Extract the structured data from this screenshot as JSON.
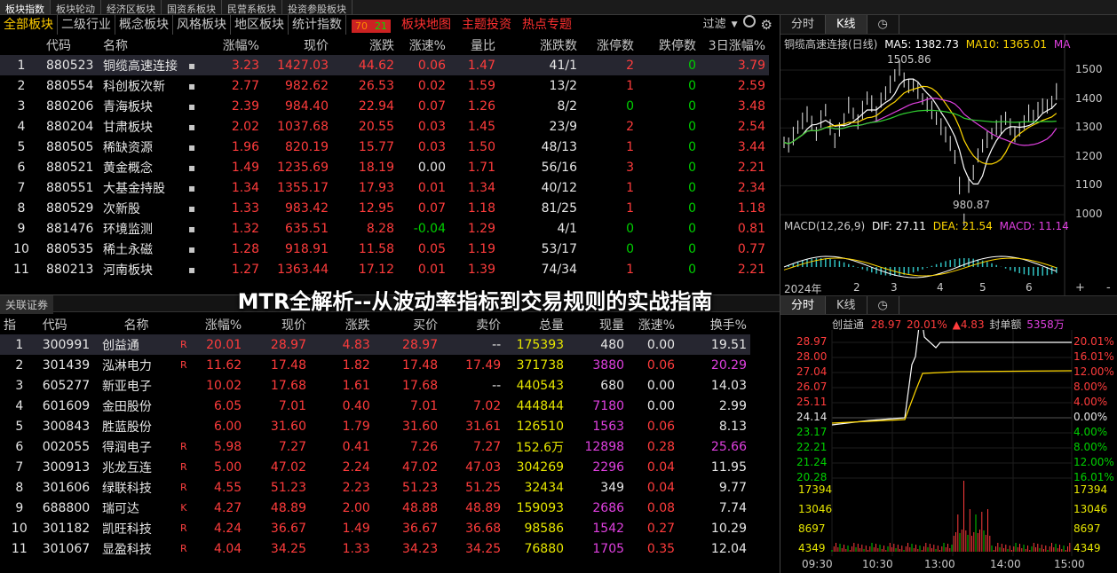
{
  "top_tabs": [
    "板块指数",
    "板块轮动",
    "经济区板块",
    "国资系板块",
    "民营系板块",
    "投资参股板块"
  ],
  "section_tabs": [
    "全部板块",
    "二级行业",
    "概念板块",
    "风格板块",
    "地区板块",
    "统计指数"
  ],
  "up_badge": "70",
  "down_badge": "21",
  "red_tabs": [
    "板块地图",
    "主题投资",
    "热点专题"
  ],
  "filter_label": "过滤",
  "sector_table": {
    "headers": [
      "代码",
      "名称",
      "",
      "涨幅%",
      "现价",
      "涨跌",
      "涨速%",
      "量比",
      "涨跌数",
      "涨停数",
      "跌停数",
      "3日涨幅%"
    ],
    "rows": [
      [
        "1",
        "880523",
        "铜缆高速连接",
        "3.23",
        "1427.03",
        "44.62",
        "0.06",
        "1.47",
        "41/1",
        "2",
        "0",
        "3.79"
      ],
      [
        "2",
        "880554",
        "科创板次新",
        "2.77",
        "982.62",
        "26.53",
        "0.02",
        "1.59",
        "13/2",
        "1",
        "0",
        "2.59"
      ],
      [
        "3",
        "880206",
        "青海板块",
        "2.39",
        "984.40",
        "22.94",
        "0.07",
        "1.26",
        "8/2",
        "0",
        "0",
        "3.48"
      ],
      [
        "4",
        "880204",
        "甘肃板块",
        "2.02",
        "1037.68",
        "20.55",
        "0.03",
        "1.45",
        "23/9",
        "2",
        "0",
        "2.54"
      ],
      [
        "5",
        "880505",
        "稀缺资源",
        "1.96",
        "820.19",
        "15.77",
        "0.03",
        "1.50",
        "48/13",
        "1",
        "0",
        "3.44"
      ],
      [
        "6",
        "880521",
        "黄金概念",
        "1.49",
        "1235.69",
        "18.19",
        "0.00",
        "1.71",
        "56/16",
        "3",
        "0",
        "2.21"
      ],
      [
        "7",
        "880551",
        "大基金持股",
        "1.34",
        "1355.17",
        "17.93",
        "0.01",
        "1.34",
        "40/12",
        "1",
        "0",
        "2.34"
      ],
      [
        "8",
        "880529",
        "次新股",
        "1.33",
        "983.42",
        "12.95",
        "0.07",
        "1.18",
        "81/25",
        "1",
        "0",
        "1.18"
      ],
      [
        "9",
        "881476",
        "环境监测",
        "1.32",
        "635.51",
        "8.28",
        "-0.04",
        "1.29",
        "4/1",
        "0",
        "0",
        "0.81"
      ],
      [
        "10",
        "880535",
        "稀土永磁",
        "1.28",
        "918.91",
        "11.58",
        "0.05",
        "1.19",
        "53/17",
        "0",
        "0",
        "0.77"
      ],
      [
        "11",
        "880213",
        "河南板块",
        "1.27",
        "1363.44",
        "17.12",
        "0.01",
        "1.39",
        "74/34",
        "1",
        "0",
        "2.21"
      ]
    ]
  },
  "related_label": "关联证券",
  "overlay_title": "MTR全解析--从波动率指标到交易规则的实战指南",
  "stock_table": {
    "headers": [
      "指",
      "代码",
      "名称",
      "",
      "涨幅%",
      "现价",
      "涨跌",
      "买价",
      "卖价",
      "总量",
      "现量",
      "涨速%",
      "换手%"
    ],
    "rows": [
      [
        "1",
        "300991",
        "创益通",
        "R",
        "20.01",
        "28.97",
        "4.83",
        "28.97",
        "--",
        "175393",
        "480",
        "0.00",
        "19.51"
      ],
      [
        "2",
        "301439",
        "泓淋电力",
        "R",
        "11.62",
        "17.48",
        "1.82",
        "17.48",
        "17.49",
        "371738",
        "3880",
        "0.06",
        "20.29"
      ],
      [
        "3",
        "605277",
        "新亚电子",
        "",
        "10.02",
        "17.68",
        "1.61",
        "17.68",
        "--",
        "440543",
        "680",
        "0.00",
        "14.03"
      ],
      [
        "4",
        "601609",
        "金田股份",
        "",
        "6.05",
        "7.01",
        "0.40",
        "7.01",
        "7.02",
        "444844",
        "7180",
        "0.00",
        "2.99"
      ],
      [
        "5",
        "300843",
        "胜蓝股份",
        "",
        "6.00",
        "31.60",
        "1.79",
        "31.60",
        "31.61",
        "126510",
        "1563",
        "0.06",
        "8.13"
      ],
      [
        "6",
        "002055",
        "得润电子",
        "R",
        "5.98",
        "7.27",
        "0.41",
        "7.26",
        "7.27",
        "152.6万",
        "12898",
        "0.28",
        "25.66"
      ],
      [
        "7",
        "300913",
        "兆龙互连",
        "R",
        "5.00",
        "47.02",
        "2.24",
        "47.02",
        "47.03",
        "304269",
        "2296",
        "0.04",
        "11.95"
      ],
      [
        "8",
        "301606",
        "绿联科技",
        "R",
        "4.55",
        "51.23",
        "2.23",
        "51.23",
        "51.25",
        "32434",
        "349",
        "0.04",
        "9.77"
      ],
      [
        "9",
        "688800",
        "瑞可达",
        "K",
        "4.27",
        "48.89",
        "2.00",
        "48.88",
        "48.89",
        "159093",
        "2686",
        "0.08",
        "7.74"
      ],
      [
        "10",
        "301182",
        "凯旺科技",
        "R",
        "4.24",
        "36.67",
        "1.49",
        "36.67",
        "36.68",
        "98586",
        "1542",
        "0.27",
        "10.29"
      ],
      [
        "11",
        "301067",
        "显盈科技",
        "R",
        "4.04",
        "34.25",
        "1.33",
        "34.23",
        "34.25",
        "76880",
        "1705",
        "0.35",
        "12.04"
      ]
    ]
  },
  "kline": {
    "tabs": [
      "分时",
      "K线"
    ],
    "title": "铜缆高速连接(日线)",
    "ma5_label": "MA5: 1382.73",
    "ma10_label": "MA10: 1365.01",
    "ma20_label": "MA",
    "high_label": "1505.86",
    "low_label": "980.87",
    "y_ticks": [
      "1500",
      "1400",
      "1300",
      "1200",
      "1100",
      "1000"
    ],
    "macd_title": "MACD(12,26,9)",
    "dif_label": "DIF: 27.11",
    "dea_label": "DEA: 21.54",
    "macd_label": "MACD: 11.14",
    "x_ticks": [
      "2024年",
      "2",
      "3",
      "4",
      "5",
      "6"
    ]
  },
  "intraday": {
    "tabs": [
      "分时",
      "K线"
    ],
    "name": "创益通",
    "price": "28.97",
    "pct": "20.01%",
    "change": "▲4.83",
    "seal_label": "封单额",
    "seal_value": "5358万",
    "left_ticks": [
      "28.97",
      "28.00",
      "27.04",
      "26.07",
      "25.11",
      "24.14",
      "23.17",
      "22.21",
      "21.24",
      "20.28"
    ],
    "right_ticks": [
      "20.01%",
      "16.01%",
      "12.00%",
      "8.00%",
      "4.00%",
      "0.00%",
      "4.00%",
      "8.00%",
      "12.00%",
      "16.01%"
    ],
    "vol_ticks": [
      "17394",
      "13046",
      "8697",
      "4349"
    ],
    "time_ticks": [
      "09:30",
      "10:30",
      "13:00",
      "14:00",
      "15:00"
    ]
  }
}
